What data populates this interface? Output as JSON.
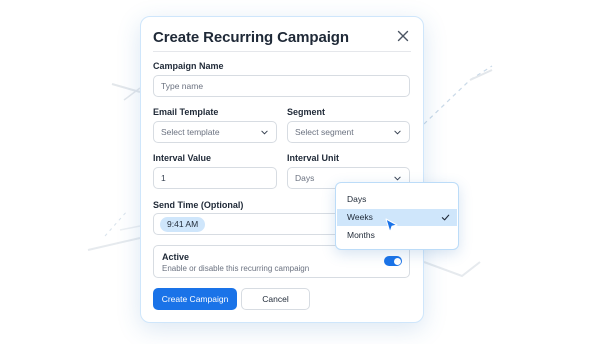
{
  "modal": {
    "title": "Create Recurring Campaign",
    "close_icon": "close-icon"
  },
  "fields": {
    "campaign_name": {
      "label": "Campaign Name",
      "placeholder": "Type name"
    },
    "email_template": {
      "label": "Email Template",
      "placeholder": "Select template"
    },
    "segment": {
      "label": "Segment",
      "placeholder": "Select segment"
    },
    "interval_value": {
      "label": "Interval Value",
      "value": "1"
    },
    "interval_unit": {
      "label": "Interval Unit",
      "value": "Days"
    },
    "send_time": {
      "label": "Send Time (Optional)",
      "value": "9:41 AM"
    }
  },
  "active": {
    "title": "Active",
    "description": "Enable or disable this recurring campaign",
    "enabled": true
  },
  "buttons": {
    "create": "Create Campaign",
    "cancel": "Cancel"
  },
  "dropdown": {
    "options": [
      "Days",
      "Weeks",
      "Months"
    ],
    "selected": "Weeks"
  },
  "colors": {
    "accent": "#1a73e8",
    "highlight": "#cfe6fb"
  }
}
